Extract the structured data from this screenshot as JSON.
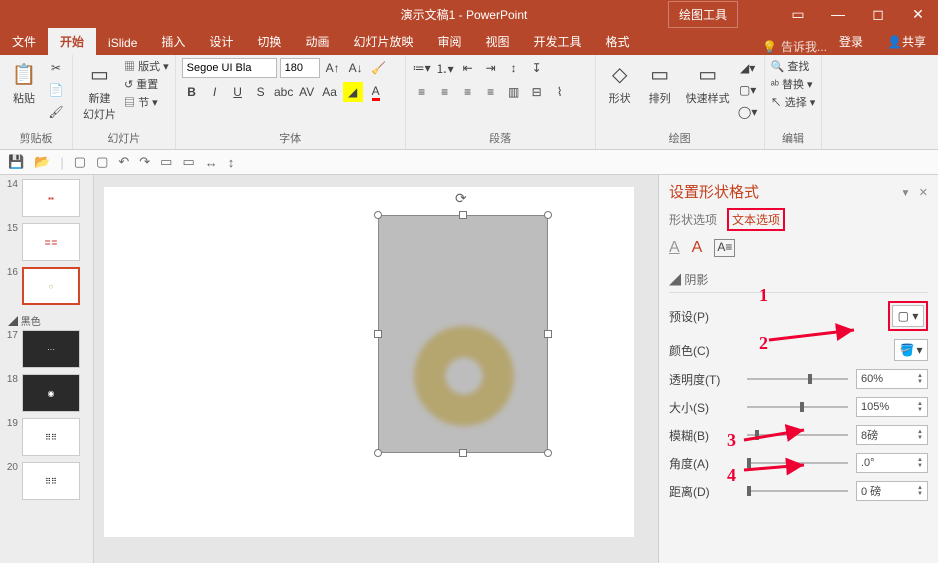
{
  "titlebar": {
    "title": "演示文稿1 - PowerPoint",
    "tools_tab": "绘图工具"
  },
  "tabs": {
    "file": "文件",
    "home": "开始",
    "islide": "iSlide",
    "insert": "插入",
    "design": "设计",
    "transitions": "切换",
    "animations": "动画",
    "slideshow": "幻灯片放映",
    "review": "审阅",
    "view": "视图",
    "developer": "开发工具",
    "format": "格式",
    "tell_me": "告诉我...",
    "login": "登录",
    "share": "共享"
  },
  "ribbon": {
    "clipboard": {
      "paste": "粘贴",
      "label": "剪贴板"
    },
    "slides": {
      "new_slide": "新建\n幻灯片",
      "layout": "版式",
      "reset": "重置",
      "section": "节",
      "label": "幻灯片"
    },
    "font": {
      "name": "Segoe UI Bla",
      "size": "180",
      "label": "字体"
    },
    "paragraph": {
      "label": "段落"
    },
    "drawing": {
      "shapes": "形状",
      "arrange": "排列",
      "quick_styles": "快速样式",
      "label": "绘图"
    },
    "editing": {
      "find": "查找",
      "replace": "替换",
      "select": "选择",
      "label": "编辑"
    }
  },
  "thumbs": {
    "section": "黑色",
    "items": [
      {
        "n": "14"
      },
      {
        "n": "15"
      },
      {
        "n": "16",
        "sel": true
      },
      {
        "n": "17",
        "dark": true
      },
      {
        "n": "18",
        "dark": true
      },
      {
        "n": "19"
      },
      {
        "n": "20"
      }
    ]
  },
  "format_panel": {
    "title": "设置形状格式",
    "tab_shape": "形状选项",
    "tab_text": "文本选项",
    "section_shadow": "阴影",
    "preset": "预设(P)",
    "color": "颜色(C)",
    "transparency": {
      "lbl": "透明度(T)",
      "val": "60%"
    },
    "size": {
      "lbl": "大小(S)",
      "val": "105%"
    },
    "blur": {
      "lbl": "模糊(B)",
      "val": "8磅"
    },
    "angle": {
      "lbl": "角度(A)",
      "val": ".0°"
    },
    "distance": {
      "lbl": "距离(D)",
      "val": "0 磅"
    }
  },
  "anno": {
    "a1": "1",
    "a2": "2",
    "a3": "3",
    "a4": "4"
  }
}
